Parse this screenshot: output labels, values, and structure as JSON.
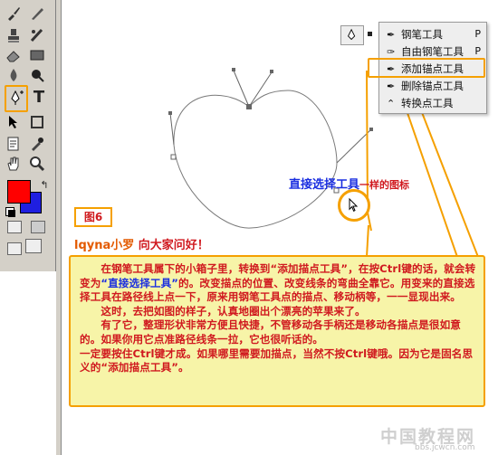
{
  "menu": {
    "items": [
      {
        "label": "钢笔工具",
        "shortcut": "P",
        "icon": "pen-icon",
        "active": true
      },
      {
        "label": "自由钢笔工具",
        "shortcut": "P",
        "icon": "freeform-pen-icon",
        "active": false
      },
      {
        "label": "添加锚点工具",
        "shortcut": "",
        "icon": "add-anchor-point-icon",
        "active": false
      },
      {
        "label": "删除锚点工具",
        "shortcut": "",
        "icon": "delete-anchor-point-icon",
        "active": false
      },
      {
        "label": "转换点工具",
        "shortcut": "",
        "icon": "convert-point-icon",
        "active": false
      }
    ]
  },
  "canvas": {
    "annotation": "直接选择工具",
    "annotation_suffix": "一样的图标",
    "figure_label": "图6"
  },
  "greeting": {
    "name": "lqyna小罗",
    "text": " 向大家问好！"
  },
  "info": {
    "p1a": "在钢笔工具属下的小箱子里，转换到“添加描点工具”，在按Ctrl键的话，就会转变为",
    "p1b": "“直接选择工具”",
    "p1c": "的。改变描点的位置、改变线条的弯曲全靠它。用变来的直接选择工具在路径线上点一下，原来用钢笔工具点的描点、移动柄等，一一显现出来。",
    "p2": "这时，去把如图的样子，认真地圈出个漂亮的苹果来了。",
    "p3": "有了它，整理形状非常方便且快捷，不管移动各手柄还是移动各描点是很如意的。如果你用它点准路径线条一拉，它也很听话的。",
    "p4": "一定要按住Ctrl键才成。如果哪里需要加描点，当然不按Ctrl键哦。因为它是固名思义的“添加描点工具”。"
  },
  "watermark": {
    "title": "中国教程网",
    "url": "bbs.jcwcn.com"
  },
  "colors": {
    "foreground": "#ff0000",
    "background": "#1f1fe0",
    "highlight": "#f5a000",
    "info_bg": "#f7f4a8"
  }
}
